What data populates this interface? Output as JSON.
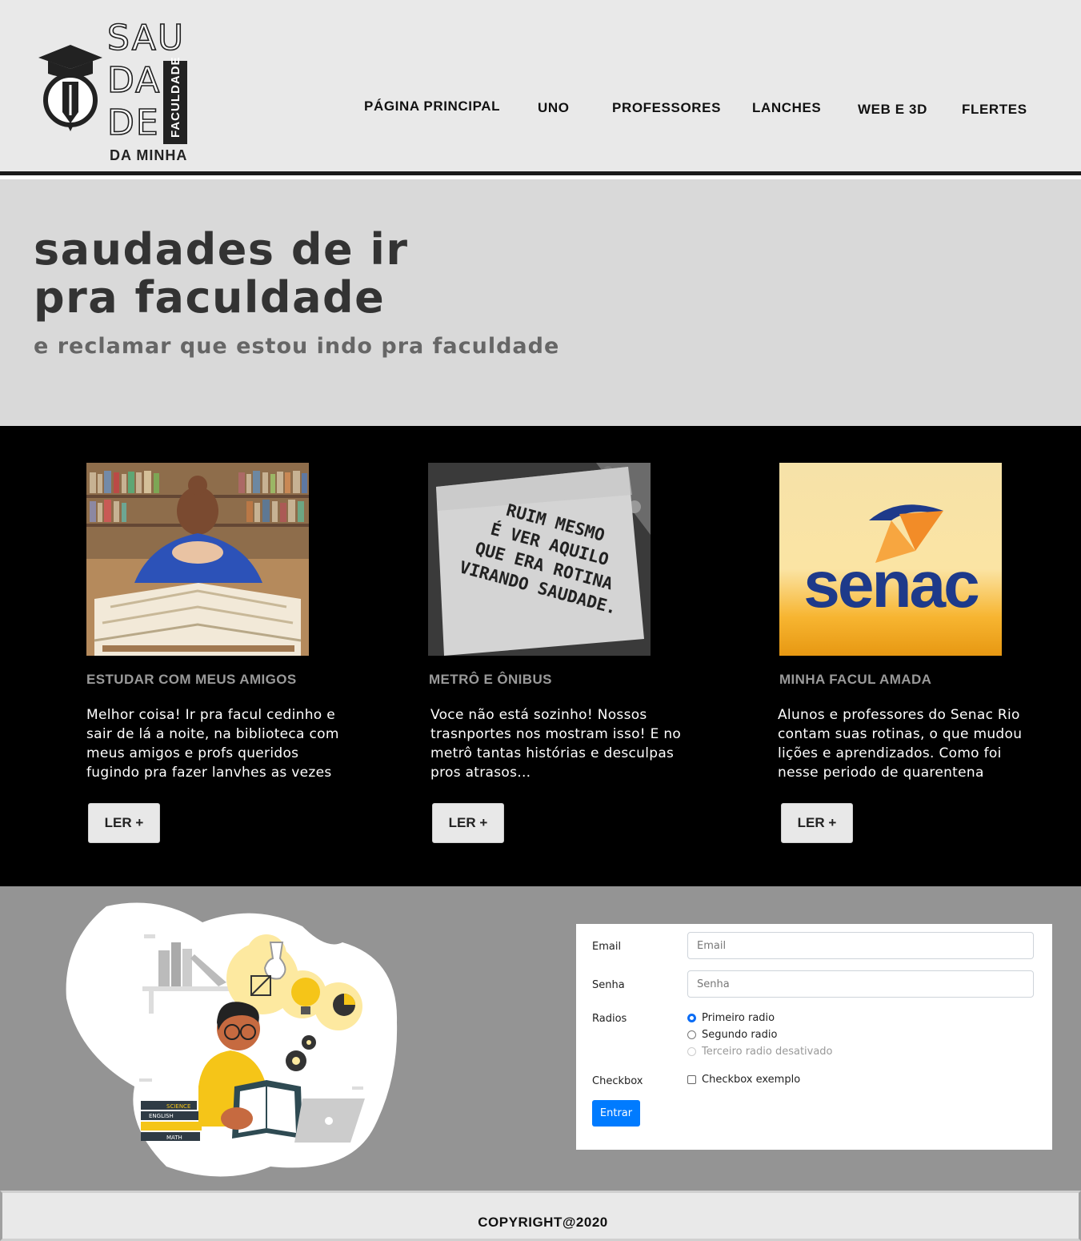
{
  "brand": {
    "logo_top": "SAU",
    "logo_mid": "DA",
    "logo_low": "DE",
    "logo_vertical": "FACULDADE",
    "logo_bottom": "DA MINHA"
  },
  "nav": {
    "items": [
      {
        "label": "PÁGINA PRINCIPAL"
      },
      {
        "label": "UNO"
      },
      {
        "label": "PROFESSORES"
      },
      {
        "label": "LANCHES"
      },
      {
        "label": "WEB E 3D"
      },
      {
        "label": "FLERTES"
      }
    ]
  },
  "hero": {
    "title_line1": "saudades de ir",
    "title_line2": "pra faculdade",
    "subtitle": "e reclamar que estou indo pra faculdade"
  },
  "cards": [
    {
      "title": "ESTUDAR COM MEUS AMIGOS",
      "text": "Melhor coisa! Ir pra facul cedinho e sair de lá a noite, na biblioteca com meus amigos e profs queridos fugindo pra fazer lanvhes as vezes",
      "button": "LER +"
    },
    {
      "title": "METRÔ E ÔNIBUS",
      "text": "Voce não está sozinho! Nossos trasnportes nos mostram isso! E no metrô tantas histórias e desculpas pros atrasos...",
      "button": "LER +",
      "image_text": [
        "RUIM MESMO",
        "É VER AQUILO",
        "QUE ERA ROTINA",
        "VIRANDO SAUDADE."
      ]
    },
    {
      "title": "MINHA FACUL AMADA",
      "text": "Alunos e professores do Senac Rio contam suas rotinas, o que mudou lições e aprendizados. Como foi nesse periodo de quarentena",
      "button": "LER +",
      "image_text": "senac"
    }
  ],
  "illustration": {
    "book_labels": [
      "SCIENCE",
      "ENGLISH",
      "MATH"
    ]
  },
  "form": {
    "email_label": "Email",
    "email_placeholder": "Email",
    "senha_label": "Senha",
    "senha_placeholder": "Senha",
    "radios_label": "Radios",
    "radios": [
      {
        "label": "Primeiro radio",
        "checked": true,
        "disabled": false
      },
      {
        "label": "Segundo radio",
        "checked": false,
        "disabled": false
      },
      {
        "label": "Terceiro radio desativado",
        "checked": false,
        "disabled": true
      }
    ],
    "checkbox_label": "Checkbox",
    "checkbox_option": "Checkbox exemplo",
    "submit": "Entrar"
  },
  "footer": {
    "copyright": "COPYRIGHT@2020"
  },
  "colors": {
    "header_bg": "#e9e9e9",
    "hero_bg": "#d9d9d9",
    "cards_bg": "#000000",
    "form_section_bg": "#949494",
    "primary_button": "#007bff"
  }
}
